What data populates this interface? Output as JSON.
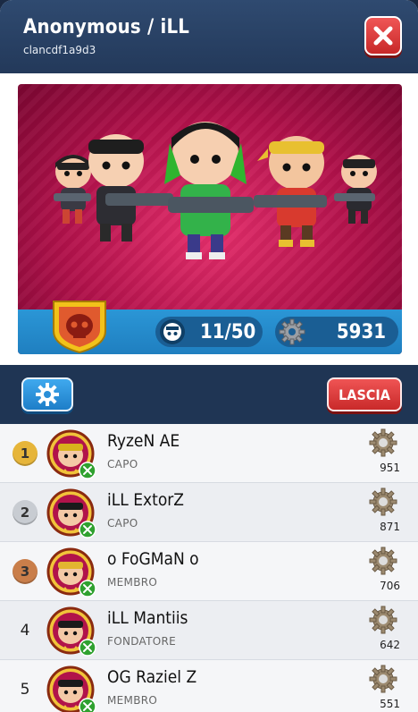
{
  "header": {
    "title": "Anonymous / iLL",
    "clan_id": "clancdf1a9d3",
    "close_icon": "close-icon"
  },
  "banner": {
    "members": "11/50",
    "gears": "5931",
    "emblem_icon": "skull-emblem-icon",
    "member_icon": "member-face-icon",
    "gear_icon": "gear-icon"
  },
  "toolbar": {
    "settings_icon": "settings-gear-icon",
    "leave_label": "LASCIA"
  },
  "members": [
    {
      "rank": "1",
      "name": "RyzeN AE",
      "role": "CAPO",
      "score": "951",
      "medal": "gold",
      "bandana": "#d8b21c"
    },
    {
      "rank": "2",
      "name": "iLL ExtorZ",
      "role": "CAPO",
      "score": "871",
      "medal": "silver",
      "bandana": "#1a1a1a"
    },
    {
      "rank": "3",
      "name": "o FoGMaN o",
      "role": "MEMBRO",
      "score": "706",
      "medal": "bronze",
      "bandana": "#e2b530"
    },
    {
      "rank": "4",
      "name": "iLL Mantiis",
      "role": "FONDATORE",
      "score": "642",
      "medal": "",
      "bandana": "#1a1a1a"
    },
    {
      "rank": "5",
      "name": "OG Raziel Z",
      "role": "MEMBRO",
      "score": "551",
      "medal": "",
      "bandana": "#1a1a1a"
    }
  ],
  "colors": {
    "gold": "#e6b53a",
    "silver": "#c8ccd2",
    "bronze": "#c97e4a",
    "xbox": "#2fa12f"
  }
}
